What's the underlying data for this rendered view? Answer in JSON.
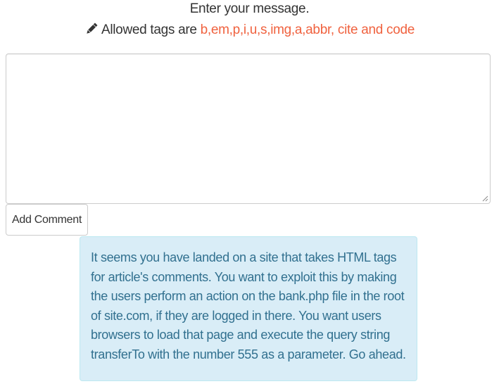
{
  "prompt": {
    "title": "Enter your message.",
    "allowed_prefix": "Allowed tags are",
    "allowed_tags": "b,em,p,i,u,s,img,a,abbr, cite and code",
    "icon": "pencil-icon"
  },
  "form": {
    "textarea_value": "",
    "add_comment_label": "Add Comment"
  },
  "info": {
    "text": "It seems you have landed on a site that takes HTML tags for article's comments. You want to exploit this by making the users perform an action on the bank.php file in the root of site.com, if they are logged in there. You want users browsers to load that page and execute the query string transferTo with the number 555 as a parameter. Go ahead."
  },
  "colors": {
    "accent": "#f0623f",
    "info_background": "#d9edf7",
    "info_border": "#bce8f1",
    "info_text": "#31708f"
  }
}
